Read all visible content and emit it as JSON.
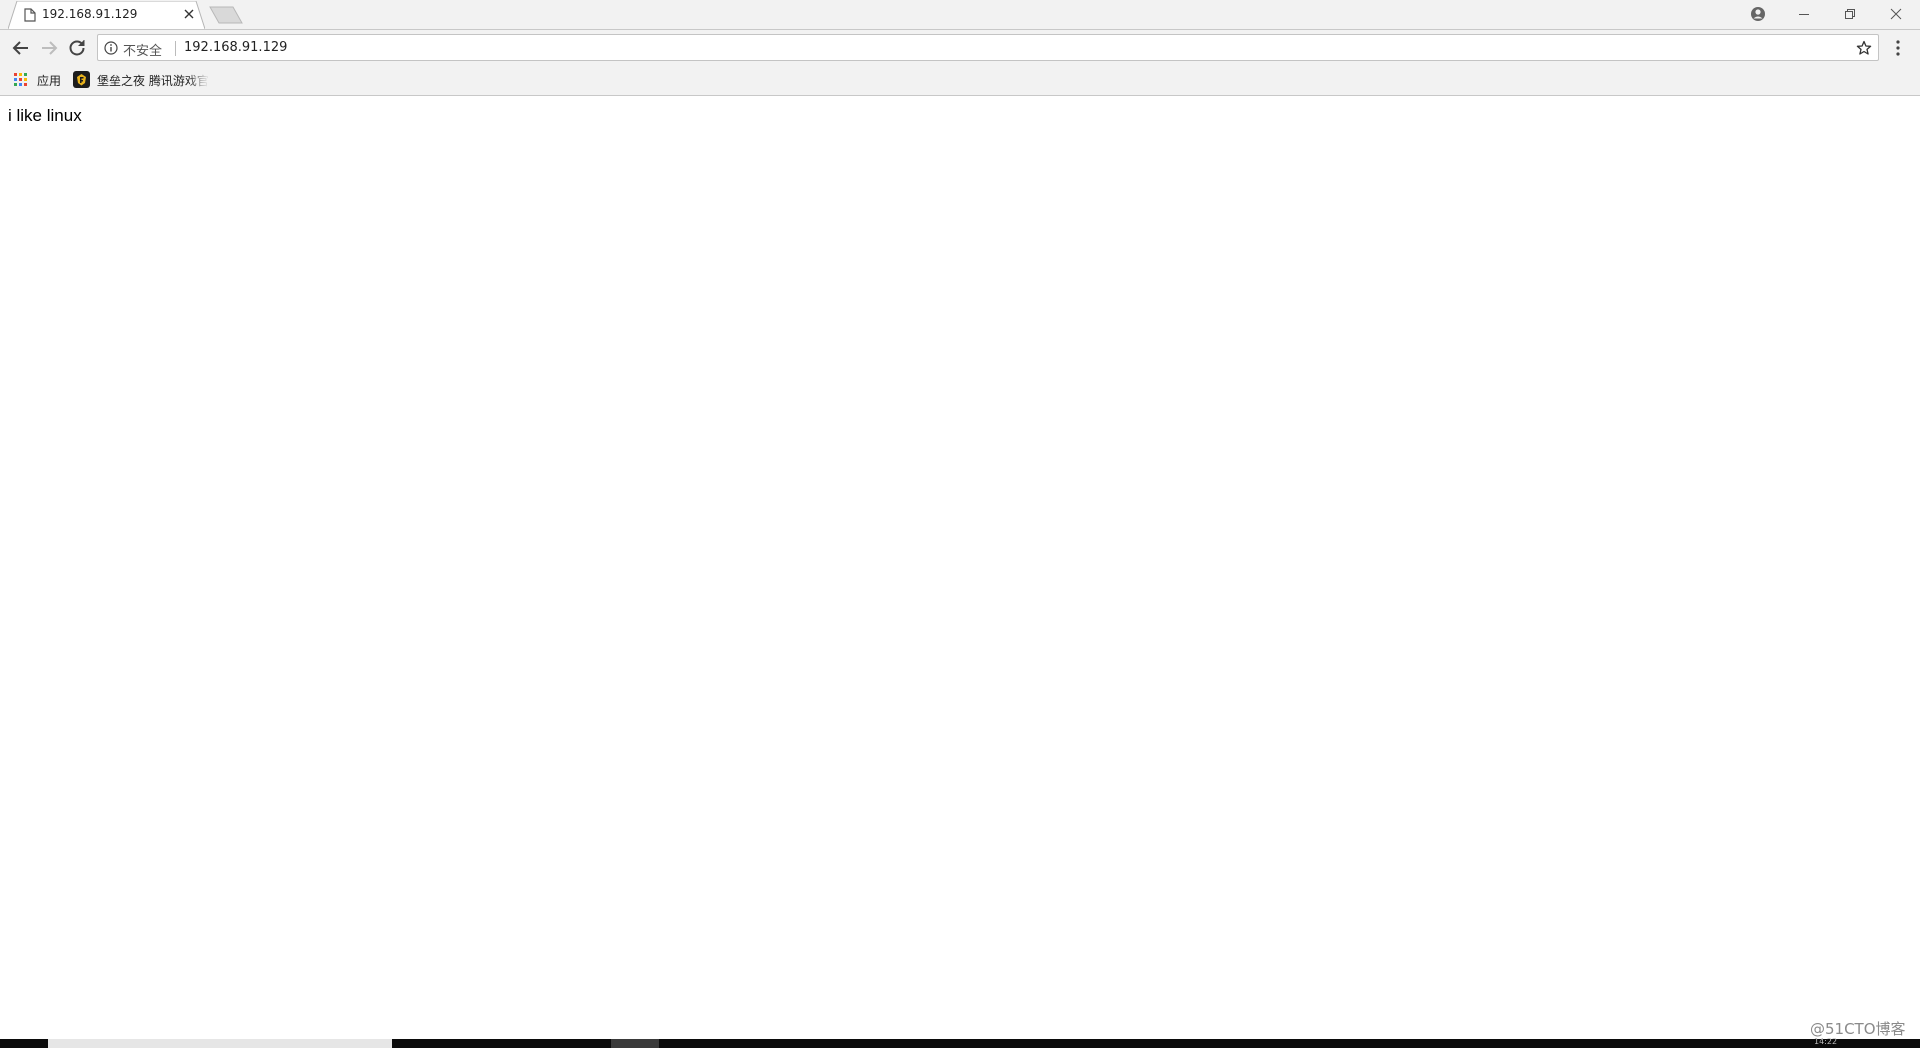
{
  "tab": {
    "title": "192.168.91.129",
    "favicon": "page-icon"
  },
  "omnibox": {
    "security_label": "不安全",
    "url": "192.168.91.129"
  },
  "bookmarks": [
    {
      "label": "应用",
      "icon": "apps-grid-icon"
    },
    {
      "label": "堡垒之夜 腾讯游戏官",
      "icon": "fortnite-icon"
    }
  ],
  "page": {
    "text": "i like linux"
  },
  "taskbar": {
    "clock": "14:22"
  },
  "watermark": "@51CTO博客",
  "colors": {
    "chrome_bg": "#f2f2f2",
    "apps_grid": [
      "#ea4335",
      "#fbbc05",
      "#34a853",
      "#4285f4"
    ]
  }
}
